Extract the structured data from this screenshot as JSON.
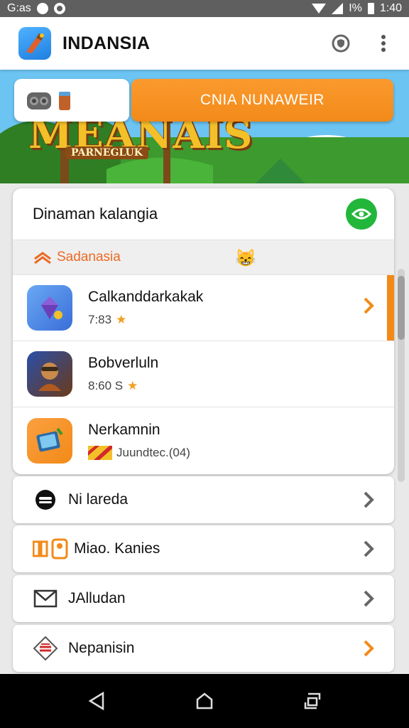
{
  "status_bar": {
    "left_text": "G:as",
    "battery_text": "I%",
    "time": "1:40"
  },
  "app_bar": {
    "title": "INDANSIA",
    "logo_icon": "game-app-logo-icon",
    "actions": [
      "shield-icon",
      "more-vert-icon"
    ]
  },
  "banner": {
    "title": "MEANAIS",
    "subtitle": "PARNEGLUK",
    "cta_label": "CNIA NUNAWEIR",
    "chip_icons": [
      "gamepad-icon",
      "cup-icon"
    ]
  },
  "card": {
    "title": "Dinaman kalangia",
    "header_icon": "eye-icon",
    "section": {
      "label": "Sadanasia",
      "emoji": "😸"
    },
    "games": [
      {
        "name": "Calkanddarkakak",
        "meta": "7:83",
        "meta_icon": "star-icon",
        "icon": "game-diamond-icon",
        "icon_bg": "#4e8fe8",
        "accent": true
      },
      {
        "name": "Bobverluln",
        "meta": "8:60 S",
        "meta_icon": "star-icon",
        "icon": "game-hero-icon",
        "icon_bg": "#2a4fa8",
        "accent": false
      },
      {
        "name": "Nerkamnin",
        "meta": "Juundtec.(04)",
        "meta_icon": "flag-icon",
        "icon": "game-tablet-icon",
        "icon_bg": "#f28a18",
        "accent": false
      }
    ]
  },
  "menu": [
    {
      "label": "Ni lareda",
      "icon": "mask-icon",
      "chevron_color": "#666666"
    },
    {
      "label": "Miao. Kanies",
      "icon": "pages-icon",
      "chevron_color": "#666666"
    },
    {
      "label": "JAlludan",
      "icon": "mail-icon",
      "chevron_color": "#666666"
    },
    {
      "label": "Nepanisin",
      "icon": "certificate-icon",
      "chevron_color": "#f28a18"
    }
  ],
  "nav_bar": {
    "buttons": [
      "back-icon",
      "home-icon",
      "recents-icon"
    ]
  },
  "colors": {
    "accent": "#f28a18",
    "green": "#22b73a",
    "section_text": "#ec6a24"
  }
}
